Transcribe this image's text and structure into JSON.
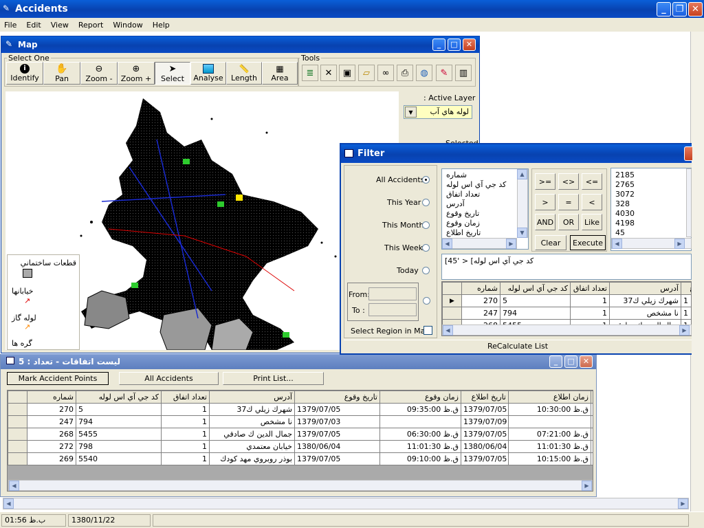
{
  "app": {
    "title": "Accidents",
    "menu": [
      "File",
      "Edit",
      "View",
      "Report",
      "Window",
      "Help"
    ]
  },
  "map_window": {
    "title": "Map",
    "group_select_label": "Select One",
    "group_tools_label": "Tools",
    "tools": [
      {
        "label": "Identify",
        "icon": "info-icon"
      },
      {
        "label": "Pan",
        "icon": "hand-icon"
      },
      {
        "label": "Zoom -",
        "icon": "zoom-out-icon"
      },
      {
        "label": "Zoom +",
        "icon": "zoom-in-icon"
      },
      {
        "label": "Select",
        "icon": "arrow-cursor-icon"
      },
      {
        "label": "Analyse",
        "icon": "analyse-icon"
      },
      {
        "label": "Length",
        "icon": "ruler-icon"
      },
      {
        "label": "Area",
        "icon": "area-icon"
      }
    ],
    "tool_icons": [
      "layers-icon",
      "delete-icon",
      "save-icon",
      "open-folder-icon",
      "binoculars-icon",
      "print-icon",
      "globe-icon",
      "pencil-icon",
      "building-icon"
    ],
    "active_layer_label": ": Active Layer",
    "active_layer_value": "لوله هاي آب",
    "selected_label": "Selected",
    "legend": [
      {
        "label": "قطعات ساختماني",
        "symbol": "gray-box"
      },
      {
        "label": "خيابانها",
        "symbol": "red-line"
      },
      {
        "label": "لوله گاز",
        "symbol": "orange-line"
      },
      {
        "label": "گره ها",
        "symbol": "point"
      }
    ]
  },
  "filter_window": {
    "title": "Filter",
    "radios": [
      {
        "label": "All Accidents",
        "checked": true
      },
      {
        "label": "This Year",
        "checked": false
      },
      {
        "label": "This Month",
        "checked": false
      },
      {
        "label": "This Week",
        "checked": false
      },
      {
        "label": "Today",
        "checked": false
      }
    ],
    "from_label": "From:",
    "to_label": "To :",
    "select_region_label": "Select Region in Map",
    "fields": [
      "شماره",
      "كد جي آي اس لوله",
      "تعداد اتفاق",
      "آدرس",
      "تاريخ وقوع",
      "زمان وقوع",
      "تاريخ اطلاع"
    ],
    "operators": [
      [
        ">=",
        "<>",
        "<="
      ],
      [
        ">",
        "=",
        "<"
      ],
      [
        "AND",
        "OR",
        "Like"
      ]
    ],
    "clear_label": "Clear",
    "execute_label": "Execute",
    "values": [
      "2185",
      "2765",
      "3072",
      "328",
      "4030",
      "4198",
      "45"
    ],
    "query_text": "كد جي آي اس لوله] < '45]",
    "grid_headers": [
      "شماره",
      "كد جي آي اس لوله",
      "تعداد اتفاق",
      "آدرس",
      "ع"
    ],
    "grid_rows": [
      {
        "id": "270",
        "gis": "5",
        "count": "1",
        "address": "شهرك زيلي ك37",
        "extra": "1"
      },
      {
        "id": "247",
        "gis": "794",
        "count": "1",
        "address": "نا مشخص",
        "extra": "1"
      },
      {
        "id": "268",
        "gis": "5455",
        "count": "1",
        "address": "جمال الدين ك صادقي",
        "extra": "1"
      }
    ],
    "recalc_label": "ReCalculate List"
  },
  "list_window": {
    "title": "ليست اتفاقات - تعداد : 5",
    "buttons": [
      "Mark Accident Points",
      "All Accidents",
      "Print List..."
    ],
    "headers": [
      "شماره",
      "كد جي آي اس لوله",
      "تعداد اتفاق",
      "آدرس",
      "تاريخ وقوع",
      "زمان وقوع",
      "تاريخ اطلاع",
      "زمان اطلاع",
      "ع"
    ],
    "rows": [
      {
        "id": "270",
        "gis": "5",
        "count": "1",
        "address": "شهرك زيلي ك37",
        "date": "1379/07/05",
        "time": "ق.ظ 09:35:00",
        "rdate": "1379/07/05",
        "rtime": "ق.ظ 10:30:00",
        "x": "ي"
      },
      {
        "id": "247",
        "gis": "794",
        "count": "1",
        "address": "نا مشخص",
        "date": "1379/07/03",
        "time": "",
        "rdate": "1379/07/09",
        "rtime": "",
        "x": ""
      },
      {
        "id": "268",
        "gis": "5455",
        "count": "1",
        "address": "جمال الدين ك صادقي",
        "date": "1379/07/05",
        "time": "ق.ظ 06:30:00",
        "rdate": "1379/07/05",
        "rtime": "ق.ظ 07:21:00",
        "x": "ي"
      },
      {
        "id": "272",
        "gis": "798",
        "count": "1",
        "address": "خيابان معتمدي",
        "date": "1380/06/04",
        "time": "ق.ظ 11:01:30",
        "rdate": "1380/06/04",
        "rtime": "ق.ظ 11:01:30",
        "x": "ي"
      },
      {
        "id": "269",
        "gis": "5540",
        "count": "1",
        "address": "بوذر روبروي مهد كودك",
        "date": "1379/07/05",
        "time": "ق.ظ 09:10:00",
        "rdate": "1379/07/05",
        "rtime": "ق.ظ 10:15:00",
        "x": "ي"
      }
    ]
  },
  "status": {
    "time": "01:56 ب.ظ",
    "date": "1380/11/22"
  }
}
